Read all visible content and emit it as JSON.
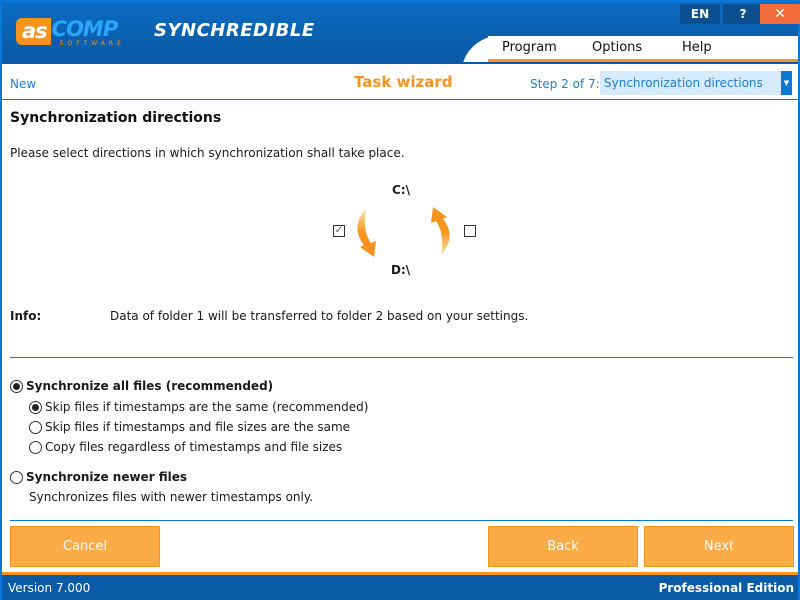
{
  "app": {
    "logo_primary": "as",
    "logo_secondary": "COMP",
    "logo_tagline": "SOFTWARE",
    "name": "SYNCHREDIBLE"
  },
  "title_buttons": {
    "language": "EN",
    "help": "?",
    "close": "✕"
  },
  "menu": {
    "items": [
      {
        "label": "Program"
      },
      {
        "label": "Options"
      },
      {
        "label": "Help"
      }
    ]
  },
  "wizard": {
    "new_link": "New",
    "title": "Task wizard",
    "step_label": "Step 2 of 7:",
    "step_selected": "Synchronization directions",
    "dropdown_arrow": "▼"
  },
  "content": {
    "title": "Synchronization directions",
    "description": "Please select directions in which synchronization shall take place.",
    "folder1": "C:\\",
    "folder2": "D:\\",
    "direction_down_checked": true,
    "direction_up_checked": false,
    "check_mark": "✓",
    "info_label": "Info:",
    "info_text": "Data of folder 1 will be transferred to folder 2 based on your settings."
  },
  "options": {
    "sync_all": {
      "label": "Synchronize all files (recommended)",
      "selected": true
    },
    "sub_options": [
      {
        "label": "Skip files if timestamps are the same (recommended)",
        "selected": true
      },
      {
        "label": "Skip files if timestamps and file sizes are the same",
        "selected": false
      },
      {
        "label": "Copy files regardless of timestamps and file sizes",
        "selected": false
      }
    ],
    "sync_newer": {
      "label": "Synchronize newer files",
      "selected": false,
      "description": "Synchronizes files with newer timestamps only."
    }
  },
  "buttons": {
    "cancel": "Cancel",
    "back": "Back",
    "next": "Next"
  },
  "status": {
    "version": "Version 7.000",
    "edition": "Professional Edition"
  },
  "colors": {
    "brand_blue": "#0a78d7",
    "header_blue": "#0a5aa5",
    "accent_orange": "#f7941d",
    "button_orange": "#fbab48",
    "close_red": "#f26b3a"
  }
}
